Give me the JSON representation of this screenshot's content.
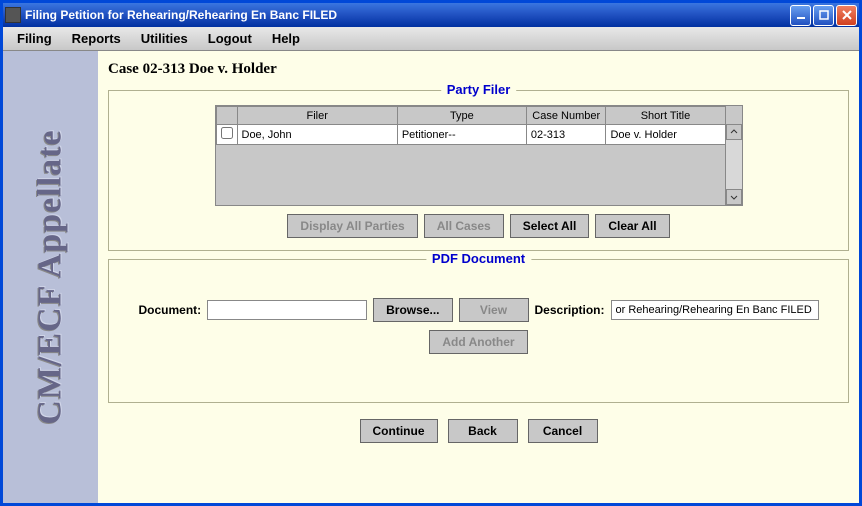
{
  "window": {
    "title": "Filing Petition for Rehearing/Rehearing En Banc FILED"
  },
  "menu": {
    "filing": "Filing",
    "reports": "Reports",
    "utilities": "Utilities",
    "logout": "Logout",
    "help": "Help"
  },
  "sidebar": {
    "logo": "CM/ECF Appellate"
  },
  "case": {
    "title": "Case 02-313 Doe v. Holder"
  },
  "party_filer": {
    "legend": "Party Filer",
    "headers": {
      "filer": "Filer",
      "type": "Type",
      "case_number": "Case Number",
      "short_title": "Short Title"
    },
    "rows": [
      {
        "filer": "Doe, John",
        "type": "Petitioner--",
        "case_number": "02-313",
        "short_title": "Doe v. Holder"
      }
    ],
    "buttons": {
      "display_all": "Display All Parties",
      "all_cases": "All Cases",
      "select_all": "Select All",
      "clear_all": "Clear All"
    }
  },
  "pdf": {
    "legend": "PDF Document",
    "document_label": "Document:",
    "document_value": "",
    "browse": "Browse...",
    "view": "View",
    "description_label": "Description:",
    "description_value": "or Rehearing/Rehearing En Banc FILED",
    "add_another": "Add Another"
  },
  "footer": {
    "continue": "Continue",
    "back": "Back",
    "cancel": "Cancel"
  }
}
